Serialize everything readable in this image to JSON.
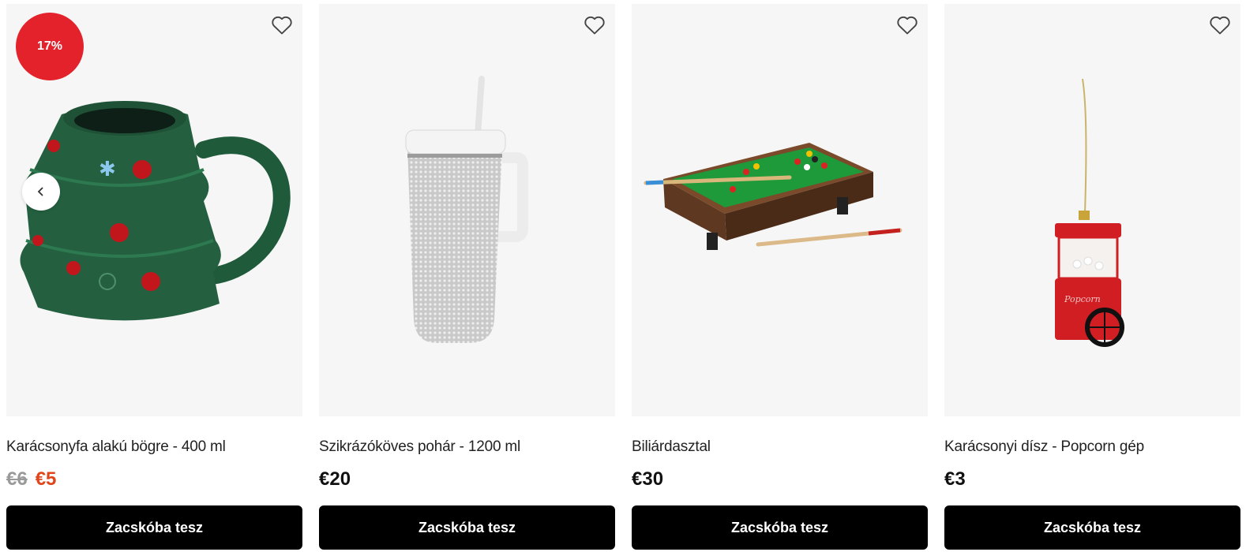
{
  "products": [
    {
      "name": "Karácsonyfa alakú bögre - 400 ml",
      "old_price": "€6",
      "price": "€5",
      "discount_badge": "17%",
      "button_label": "Zacskóba tesz",
      "image": "christmas-tree-mug"
    },
    {
      "name": "Szikrázóköves pohár - 1200 ml",
      "price": "€20",
      "button_label": "Zacskóba tesz",
      "image": "glitter-tumbler"
    },
    {
      "name": "Biliárdasztal",
      "price": "€30",
      "button_label": "Zacskóba tesz",
      "image": "mini-pool-table"
    },
    {
      "name": "Karácsonyi dísz - Popcorn gép",
      "price": "€3",
      "button_label": "Zacskóba tesz",
      "image": "popcorn-machine-ornament"
    }
  ],
  "colors": {
    "badge": "#e3222c",
    "sale_price": "#e0461b",
    "old_price": "#9a9a9a",
    "button_bg": "#000000"
  },
  "icons": {
    "favorite": "heart-outline-icon",
    "carousel_prev": "chevron-left-icon"
  }
}
